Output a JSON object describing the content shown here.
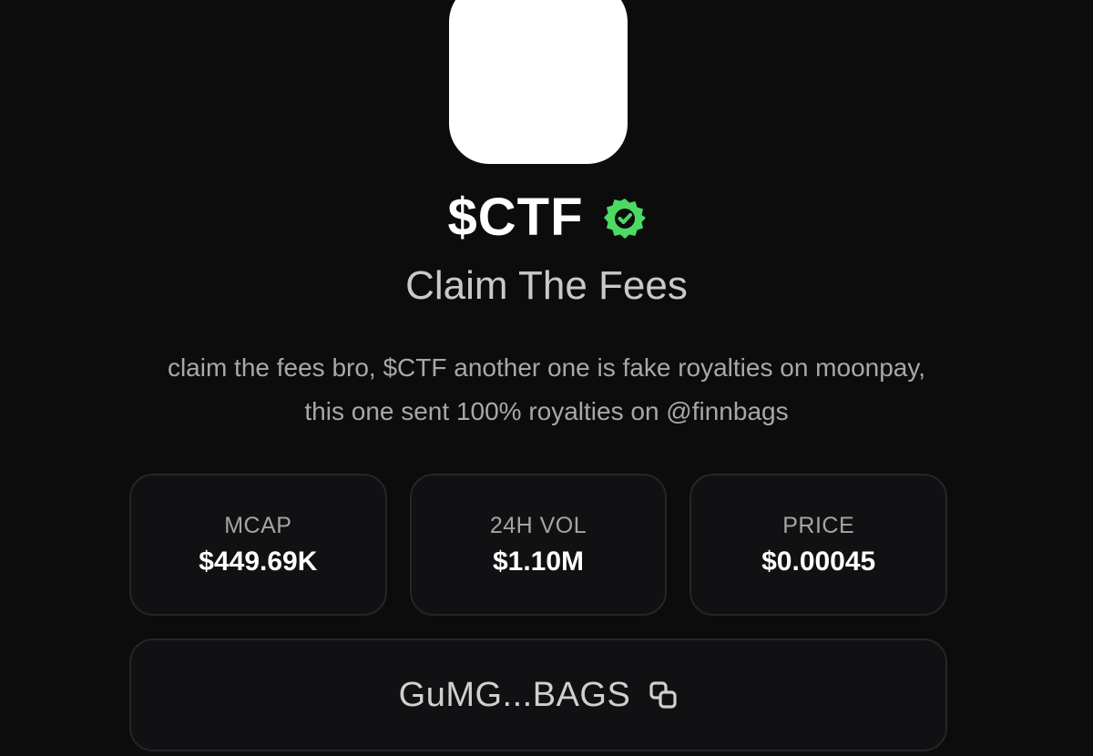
{
  "token": {
    "ticker": "$CTF",
    "name": "Claim The Fees",
    "description": "claim the fees bro, $CTF another one is fake royalties on moonpay, this one sent 100% royalties on @finnbags",
    "verified_icon": "verified-badge-icon",
    "verified_color": "#4cd964"
  },
  "stats": [
    {
      "label": "MCAP",
      "value": "$449.69K"
    },
    {
      "label": "24H VOL",
      "value": "$1.10M"
    },
    {
      "label": "PRICE",
      "value": "$0.00045"
    }
  ],
  "address": {
    "short": "GuMG...BAGS",
    "icon": "copy-icon"
  }
}
